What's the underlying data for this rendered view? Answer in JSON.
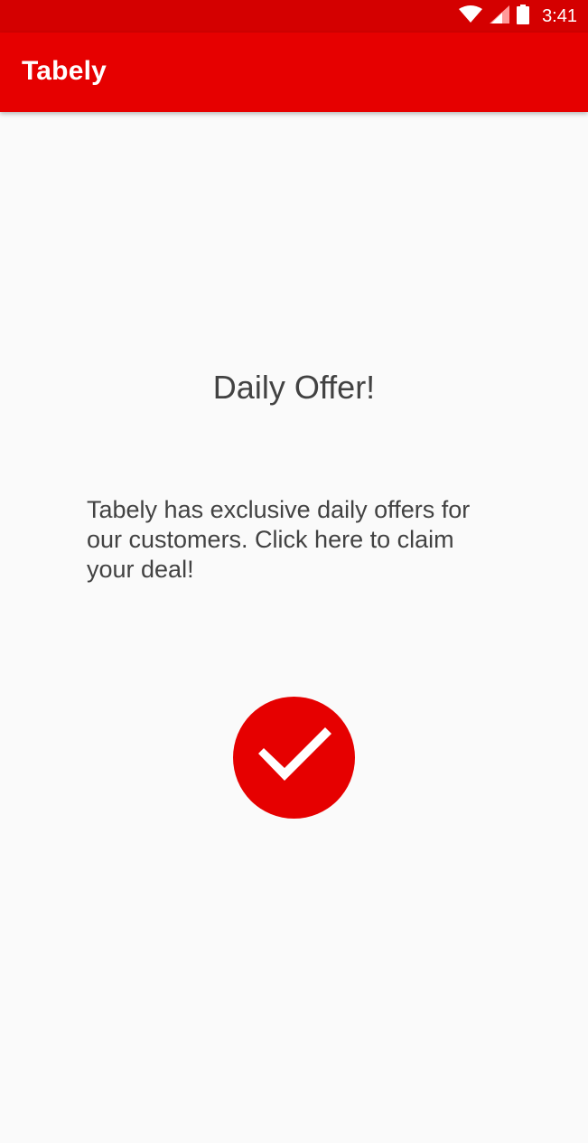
{
  "status_bar": {
    "time": "3:41",
    "icons": [
      "wifi-icon",
      "cellular-signal-icon",
      "battery-icon"
    ]
  },
  "app_bar": {
    "title": "Tabely"
  },
  "offer": {
    "title": "Daily Offer!",
    "description": "Tabely has exclusive daily offers for our customers. Click here to claim your deal!",
    "button_icon": "check-icon"
  },
  "colors": {
    "status_bar": "#d40000",
    "app_bar": "#e60000",
    "accent": "#e60000",
    "background": "#fafafa",
    "text": "#424242"
  }
}
